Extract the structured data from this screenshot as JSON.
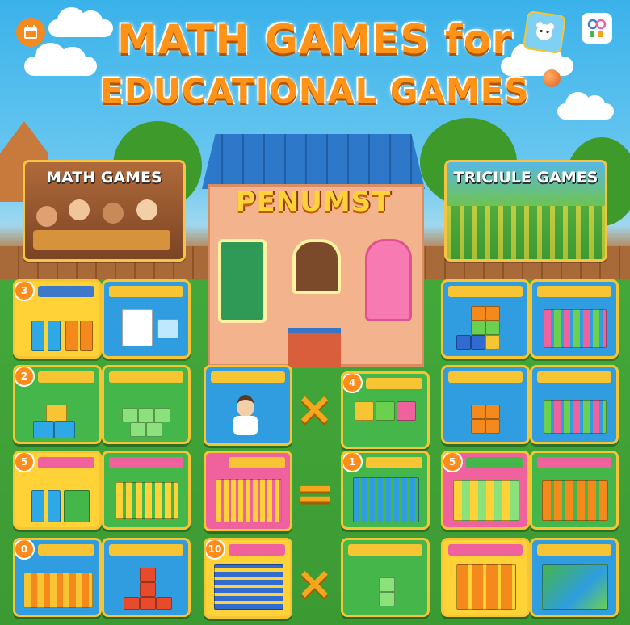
{
  "header": {
    "title_line1": "MATH GAMES for",
    "title_line2": "EDUCATIONAL GAMES"
  },
  "house": {
    "sign": "PENUMST"
  },
  "panels": {
    "left_label": "MATH GAMES",
    "right_label": "TRICIULE GAMES"
  },
  "operators": {
    "times_top": "×",
    "equals": "=",
    "times_bottom": "×"
  },
  "cards": [
    {
      "id": "c1",
      "num": "3"
    },
    {
      "id": "c2",
      "num": ""
    },
    {
      "id": "c3",
      "num": ""
    },
    {
      "id": "c4",
      "num": ""
    },
    {
      "id": "c5",
      "num": "2"
    },
    {
      "id": "c6",
      "num": ""
    },
    {
      "id": "c7",
      "num": ""
    },
    {
      "id": "c8",
      "num": "4"
    },
    {
      "id": "c9",
      "num": ""
    },
    {
      "id": "c10",
      "num": ""
    },
    {
      "id": "c11",
      "num": "5"
    },
    {
      "id": "c12",
      "num": ""
    },
    {
      "id": "c13",
      "num": ""
    },
    {
      "id": "c14",
      "num": "1"
    },
    {
      "id": "c15",
      "num": "5"
    },
    {
      "id": "c16",
      "num": ""
    },
    {
      "id": "c17",
      "num": "0"
    },
    {
      "id": "c18",
      "num": ""
    },
    {
      "id": "c19",
      "num": "10"
    },
    {
      "id": "c20",
      "num": ""
    },
    {
      "id": "c21",
      "num": ""
    },
    {
      "id": "c22",
      "num": ""
    }
  ],
  "colors": {
    "title_orange": "#ff9317",
    "card_border": "#f7c533",
    "roof_blue": "#2d78c8",
    "grass_green": "#3c9a33"
  },
  "icons": [
    "calendar-app-icon",
    "bear-app-icon",
    "abc-app-icon",
    "ball-icon"
  ]
}
